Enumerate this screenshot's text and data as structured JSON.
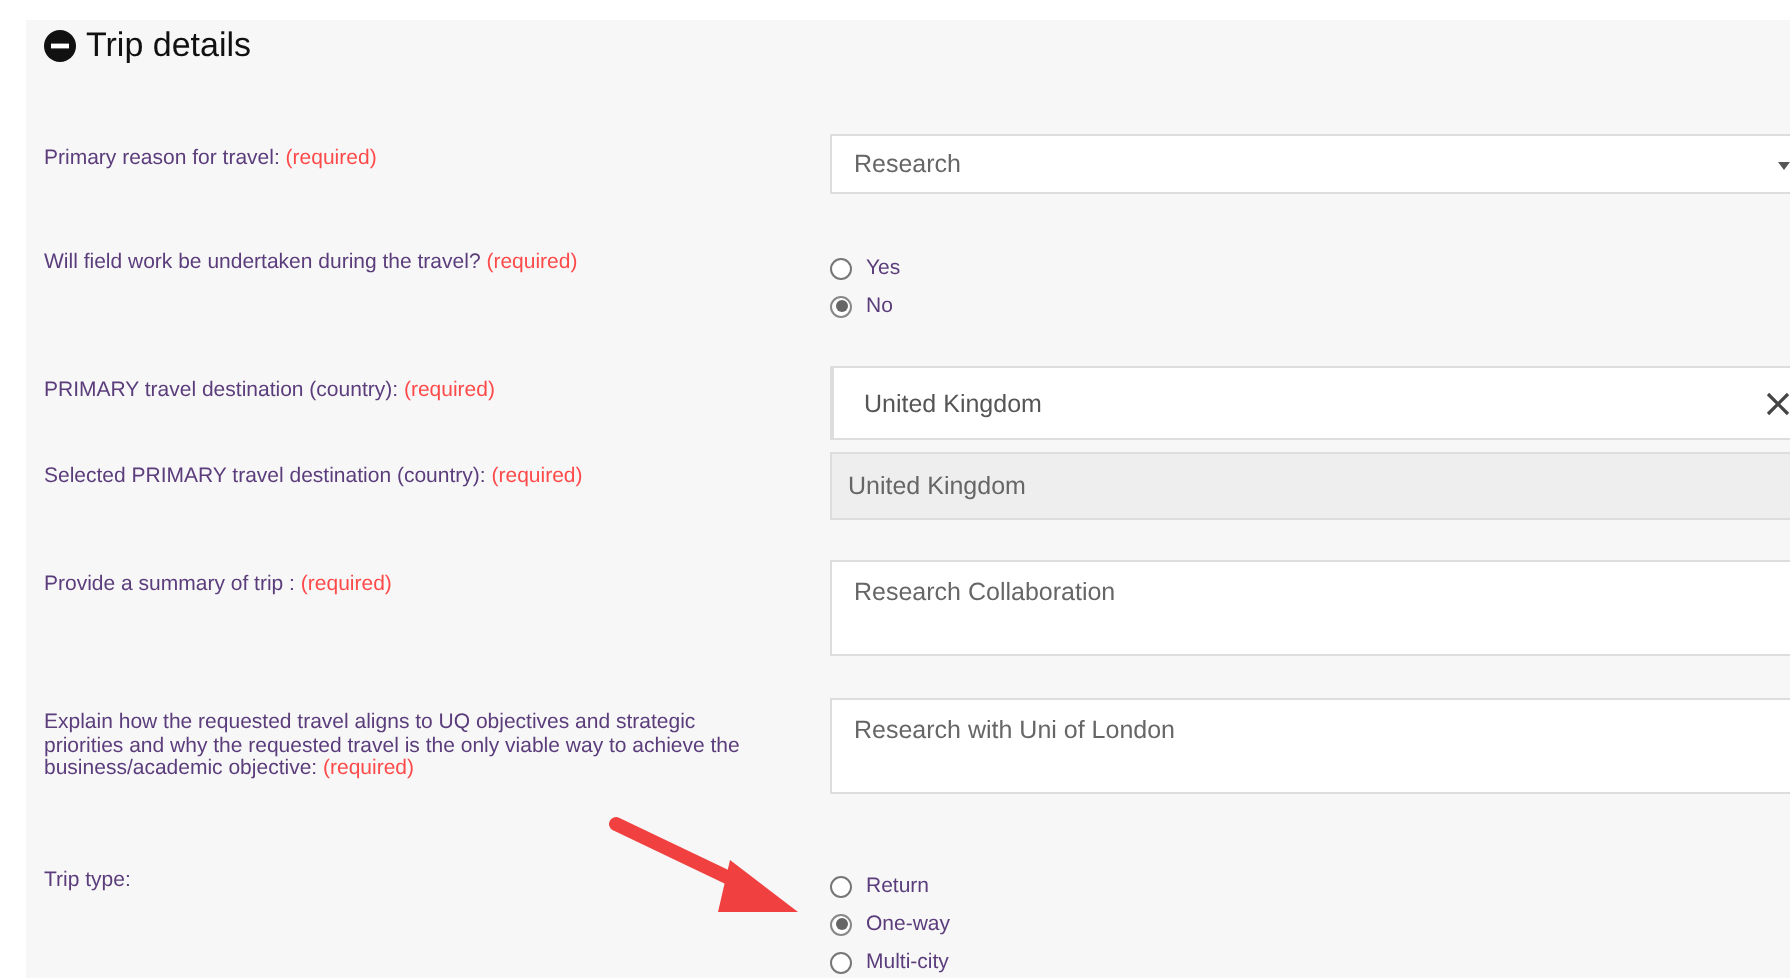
{
  "section": {
    "title": "Trip details",
    "expanded": true
  },
  "fields": [
    {
      "kind": "select",
      "label": "Primary reason for travel:",
      "required": "(required)",
      "value": "Research"
    },
    {
      "kind": "radio",
      "label": "Will field work be undertaken during the travel?",
      "required": "(required)",
      "options": [
        {
          "label": "Yes",
          "selected": false
        },
        {
          "label": "No",
          "selected": true
        }
      ]
    },
    {
      "kind": "search",
      "label": "PRIMARY travel destination (country):",
      "required": "(required)",
      "value": "United Kingdom"
    },
    {
      "kind": "text",
      "label": "Selected PRIMARY travel destination (country):",
      "required": "(required)",
      "value": "United Kingdom",
      "disabled": true
    },
    {
      "kind": "textarea",
      "label": "Provide a summary of trip :",
      "required": "(required)",
      "value": "Research Collaboration"
    },
    {
      "kind": "textarea",
      "label": "Explain how the requested travel aligns to UQ objectives and strategic priorities and why the requested travel is the only viable way to achieve the business/academic objective:",
      "required": "(required)",
      "value": "Research with Uni of London"
    },
    {
      "kind": "radio",
      "label": "Trip type:",
      "options": [
        {
          "label": "Return",
          "selected": false
        },
        {
          "label": "One-way",
          "selected": true
        },
        {
          "label": "Multi-city",
          "selected": false
        }
      ]
    }
  ]
}
